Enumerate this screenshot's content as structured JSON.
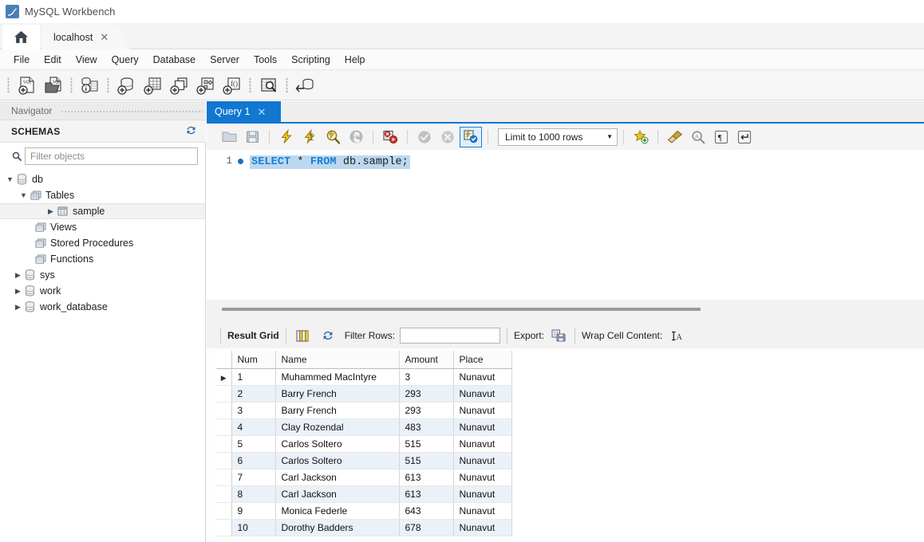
{
  "window": {
    "title": "MySQL Workbench",
    "logo_icon": "mysql-dolphin-logo"
  },
  "tabstrip": {
    "home_tab_icon": "home-icon",
    "connection_tab": {
      "label": "localhost",
      "close_icon": "close-icon"
    }
  },
  "menubar": {
    "items": [
      {
        "label": "File"
      },
      {
        "label": "Edit"
      },
      {
        "label": "View"
      },
      {
        "label": "Query"
      },
      {
        "label": "Database"
      },
      {
        "label": "Server"
      },
      {
        "label": "Tools"
      },
      {
        "label": "Scripting"
      },
      {
        "label": "Help"
      }
    ]
  },
  "main_toolbar": {
    "buttons": [
      {
        "icon": "new-sql-tab-icon"
      },
      {
        "icon": "open-sql-script-icon"
      },
      {
        "icon": "server-status-icon"
      },
      {
        "icon": "new-schema-icon"
      },
      {
        "icon": "new-table-icon"
      },
      {
        "icon": "new-view-icon"
      },
      {
        "icon": "new-stored-procedure-icon"
      },
      {
        "icon": "new-function-icon"
      },
      {
        "icon": "search-data-icon"
      },
      {
        "icon": "reconnect-server-icon"
      }
    ]
  },
  "navigator": {
    "header": "Navigator",
    "schemas_title": "SCHEMAS",
    "refresh_icon": "refresh-icon",
    "filter": {
      "placeholder": "Filter objects",
      "value": "",
      "icon": "search-icon"
    },
    "tree": [
      {
        "label": "db",
        "icon": "schema-icon",
        "expander": "expanded",
        "indent": 0,
        "selected": false
      },
      {
        "label": "Tables",
        "icon": "folder-tables-icon",
        "expander": "expanded",
        "indent": 1,
        "selected": false
      },
      {
        "label": "sample",
        "icon": "table-icon",
        "expander": "collapsed",
        "indent": 2,
        "selected": true
      },
      {
        "label": "Views",
        "icon": "folder-views-icon",
        "expander": "none",
        "indent": 1,
        "selected": false
      },
      {
        "label": "Stored Procedures",
        "icon": "folder-procedures-icon",
        "expander": "none",
        "indent": 1,
        "selected": false
      },
      {
        "label": "Functions",
        "icon": "folder-functions-icon",
        "expander": "none",
        "indent": 1,
        "selected": false
      },
      {
        "label": "sys",
        "icon": "schema-icon",
        "expander": "collapsed",
        "indent": 0,
        "selected": false
      },
      {
        "label": "work",
        "icon": "schema-icon",
        "expander": "collapsed",
        "indent": 0,
        "selected": false
      },
      {
        "label": "work_database",
        "icon": "schema-icon",
        "expander": "collapsed",
        "indent": 0,
        "selected": false
      }
    ]
  },
  "editor": {
    "tab": {
      "label": "Query 1",
      "close_icon": "close-icon"
    },
    "toolbar": {
      "buttons": [
        {
          "icon": "open-script-icon"
        },
        {
          "icon": "save-script-icon"
        },
        {
          "icon": "execute-statement-icon"
        },
        {
          "icon": "execute-current-statement-icon"
        },
        {
          "icon": "explain-query-icon"
        },
        {
          "icon": "stop-query-icon"
        },
        {
          "icon": "toggle-stop-on-error-icon"
        },
        {
          "icon": "commit-icon"
        },
        {
          "icon": "rollback-icon"
        },
        {
          "icon": "toggle-autocommit-icon"
        }
      ],
      "limit_label": "Limit to 1000 rows",
      "right_buttons": [
        {
          "icon": "add-snippet-icon"
        },
        {
          "icon": "beautify-sql-icon"
        },
        {
          "icon": "find-icon"
        },
        {
          "icon": "toggle-invisible-chars-icon"
        },
        {
          "icon": "toggle-word-wrap-icon"
        }
      ]
    },
    "line_number": "1",
    "sql": {
      "tokens": [
        {
          "text": "SELECT",
          "type": "keyword"
        },
        {
          "text": " * ",
          "type": "plain"
        },
        {
          "text": "FROM",
          "type": "keyword"
        },
        {
          "text": " db.sample;",
          "type": "plain"
        }
      ]
    }
  },
  "results": {
    "toolbar": {
      "result_grid_label": "Result Grid",
      "grid_view_icon": "grid-view-icon",
      "refresh_icon": "refresh-icon",
      "filter_rows_label": "Filter Rows:",
      "filter_rows_value": "",
      "export_label": "Export:",
      "export_icon": "export-recordset-icon",
      "wrap_cell_label": "Wrap Cell Content:",
      "wrap_cell_icon": "wrap-cell-icon"
    },
    "columns": [
      "Num",
      "Name",
      "Amount",
      "Place"
    ],
    "rows": [
      {
        "marker": true,
        "Num": "1",
        "Name": "Muhammed MacIntyre",
        "Amount": "3",
        "Place": "Nunavut"
      },
      {
        "marker": false,
        "Num": "2",
        "Name": "Barry French",
        "Amount": "293",
        "Place": "Nunavut"
      },
      {
        "marker": false,
        "Num": "3",
        "Name": "Barry French",
        "Amount": "293",
        "Place": "Nunavut"
      },
      {
        "marker": false,
        "Num": "4",
        "Name": "Clay Rozendal",
        "Amount": "483",
        "Place": "Nunavut"
      },
      {
        "marker": false,
        "Num": "5",
        "Name": "Carlos Soltero",
        "Amount": "515",
        "Place": "Nunavut"
      },
      {
        "marker": false,
        "Num": "6",
        "Name": "Carlos Soltero",
        "Amount": "515",
        "Place": "Nunavut"
      },
      {
        "marker": false,
        "Num": "7",
        "Name": "Carl Jackson",
        "Amount": "613",
        "Place": "Nunavut"
      },
      {
        "marker": false,
        "Num": "8",
        "Name": "Carl Jackson",
        "Amount": "613",
        "Place": "Nunavut"
      },
      {
        "marker": false,
        "Num": "9",
        "Name": "Monica Federle",
        "Amount": "643",
        "Place": "Nunavut"
      },
      {
        "marker": false,
        "Num": "10",
        "Name": "Dorothy Badders",
        "Amount": "678",
        "Place": "Nunavut"
      }
    ]
  },
  "colors": {
    "accent_blue": "#1177d1",
    "selection_blue": "#bcd8f0",
    "alt_row": "#eaf1f9",
    "keyword_blue": "#1b7fd4"
  }
}
